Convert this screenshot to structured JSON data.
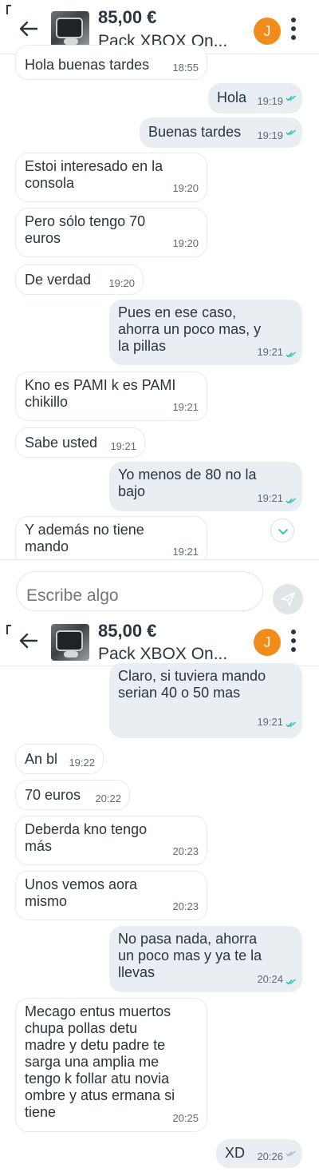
{
  "header": {
    "price": "85,00 €",
    "title": "Pack XBOX On...",
    "avatar_initial": "J"
  },
  "composer": {
    "placeholder": "Escribe algo"
  },
  "colors": {
    "accent": "#f08c1c",
    "read_ticks": "#13c1ac",
    "out_bubble": "#e8eef1",
    "in_bubble": "#ffffff"
  },
  "screen1": {
    "messages": [
      {
        "dir": "in",
        "text": "Hola buenas tardes",
        "time": "18:55"
      },
      {
        "dir": "out",
        "text": "Hola",
        "time": "19:19",
        "status": "read"
      },
      {
        "dir": "out",
        "text": "Buenas tardes",
        "time": "19:19",
        "status": "read"
      },
      {
        "dir": "in",
        "text": "Estoi interesado en la\nconsola",
        "time": "19:20"
      },
      {
        "dir": "in",
        "text": "Pero sólo tengo 70\neuros",
        "time": "19:20"
      },
      {
        "dir": "in",
        "text": "De verdad",
        "time": "19:20"
      },
      {
        "dir": "out",
        "text": "Pues en ese caso,\nahorra un poco mas, y\nla pillas",
        "time": "19:21",
        "status": "read"
      },
      {
        "dir": "in",
        "text": "Kno es PAMI k es PAMI\nchikillo",
        "time": "19:21"
      },
      {
        "dir": "in",
        "text": "Sabe usted",
        "time": "19:21"
      },
      {
        "dir": "out",
        "text": "Yo menos de 80 no la\nbajo",
        "time": "19:21",
        "status": "read"
      },
      {
        "dir": "in",
        "text": "Y además no tiene\nmando",
        "time": "19:21"
      }
    ]
  },
  "screen2": {
    "messages": [
      {
        "dir": "out",
        "text": "Claro, si tuviera mando\nserian 40 o 50 mas",
        "time": "19:21",
        "status": "read"
      },
      {
        "dir": "in",
        "text": "An bl",
        "time": "19:22"
      },
      {
        "dir": "in",
        "text": "70 euros",
        "time": "20:22"
      },
      {
        "dir": "in",
        "text": "Deberda kno tengo\nmás",
        "time": "20:23"
      },
      {
        "dir": "in",
        "text": "Unos vemos aora\nmismo",
        "time": "20:23"
      },
      {
        "dir": "out",
        "text": "No pasa nada, ahorra\nun poco mas y ya te la\nllevas",
        "time": "20:24",
        "status": "read"
      },
      {
        "dir": "in",
        "text": "Mecago entus muertos\nchupa pollas detu\nmadre y detu padre te\nsarga una amplia me\ntengo k follar atu novia\nombre y atus ermana si\ntiene",
        "time": "20:25"
      },
      {
        "dir": "out",
        "text": "XD",
        "time": "20:26",
        "status": "sent"
      }
    ]
  }
}
